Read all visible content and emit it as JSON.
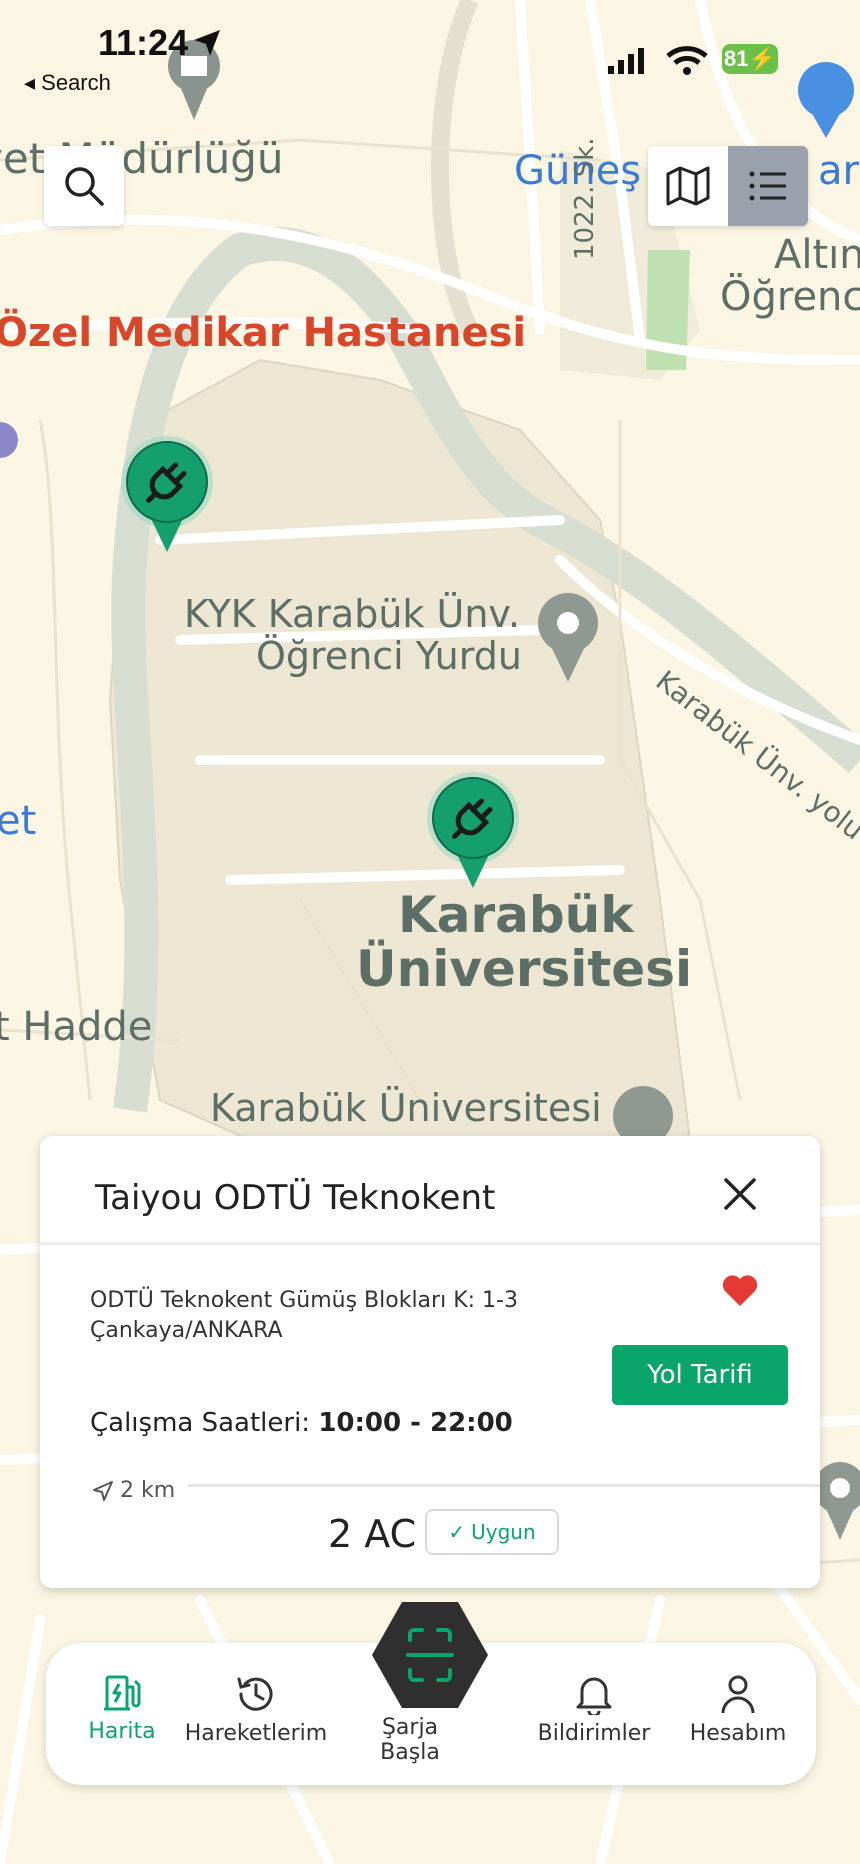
{
  "status_bar": {
    "time": "11:24",
    "back_label": "Search",
    "battery": "81"
  },
  "map": {
    "labels": {
      "mudurlugu": "vet Müdürlüğü",
      "gunes": "Güneş",
      "park": "ark",
      "altin": "Altın",
      "ogrenc": "Öğrenc",
      "street1022": "1022. Sk.",
      "hospital": "Özel Medikar Hastanesi",
      "kyk_line1": "KYK Karabük Ünv.",
      "kyk_line2": "Öğrenci Yurdu",
      "road": "Karabük Ünv. yolu",
      "et": "et",
      "uni_line1": "Karabük",
      "uni_line2": "Üniversitesi",
      "hadde": "t Hadde",
      "uni_lib": "Karabük Üniversitesi"
    }
  },
  "colors": {
    "accent": "#0aa56b",
    "marker": "#159e6e",
    "heart": "#e53935"
  },
  "station_card": {
    "title": "Taiyou ODTÜ Teknokent",
    "address_line1": "ODTÜ Teknokent Gümüş Blokları K: 1-3",
    "address_line2": "Çankaya/ANKARA",
    "directions_button": "Yol Tarifi",
    "hours_label": "Çalışma Saatleri:",
    "hours_value": "10:00 - 22:00",
    "distance": "2 km",
    "connector": "2 AC",
    "availability": "Uygun"
  },
  "bottom_nav": {
    "items": [
      {
        "label": "Harita",
        "icon": "charging-station-icon"
      },
      {
        "label": "Hareketlerim",
        "icon": "history-icon"
      },
      {
        "label": "Şarja Başla",
        "icon": "scan-icon"
      },
      {
        "label": "Bildirimler",
        "icon": "bell-icon"
      },
      {
        "label": "Hesabım",
        "icon": "user-icon"
      }
    ]
  }
}
